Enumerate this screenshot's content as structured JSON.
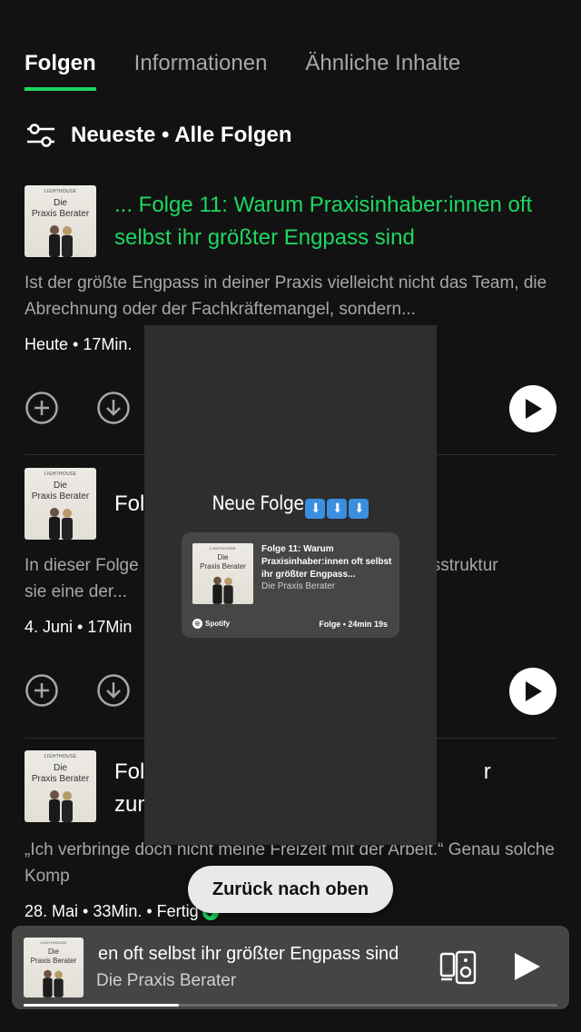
{
  "tabs": [
    {
      "label": "Folgen"
    },
    {
      "label": "Informationen"
    },
    {
      "label": "Ähnliche Inhalte"
    }
  ],
  "filter": {
    "label": "Neueste • Alle Folgen"
  },
  "cover": {
    "small": "LIGHTHOUSE",
    "title_line1": "Die",
    "title_line2": "Praxis Berater"
  },
  "episodes": [
    {
      "title": "... Folge 11: Warum Praxisinhaber:innen oft selbst ihr größter Engpass sind",
      "description": "Ist der größte Engpass in deiner Praxis vielleicht nicht das Team, die Abrechnung oder der Fachkräftemangel, sondern...",
      "meta": "Heute • 17Min."
    },
    {
      "title": "Fol",
      "description": "In dieser Folge                                           hema Praxisstruktur                                          sie eine der...",
      "meta": "4. Juni • 17Min"
    },
    {
      "title": "Fol                                                        r zum Sor",
      "description": "„Ich verbringe doch nicht meine Freizeit mit der Arbeit.“ Genau solche Komp                              er unserem virale...",
      "meta": "28. Mai • 33Min. • Fertig"
    }
  ],
  "story": {
    "title": "Neue Folge",
    "arrow_emoji": "⬇",
    "card_title": "Folge 11: Warum Praxisinhaber:innen oft selbst ihr größter Engpass...",
    "card_show": "Die Praxis Berater",
    "card_brand": "Spotify",
    "card_duration": "Folge • 24min 19s"
  },
  "back_to_top": "Zurück nach oben",
  "mini_player": {
    "title": "en oft selbst ihr größter Engpass sind",
    "show": "Die Praxis Berater",
    "progress": 0.29
  },
  "colors": {
    "accent": "#1ed760",
    "background": "#121212",
    "mini_player": "#454545"
  }
}
